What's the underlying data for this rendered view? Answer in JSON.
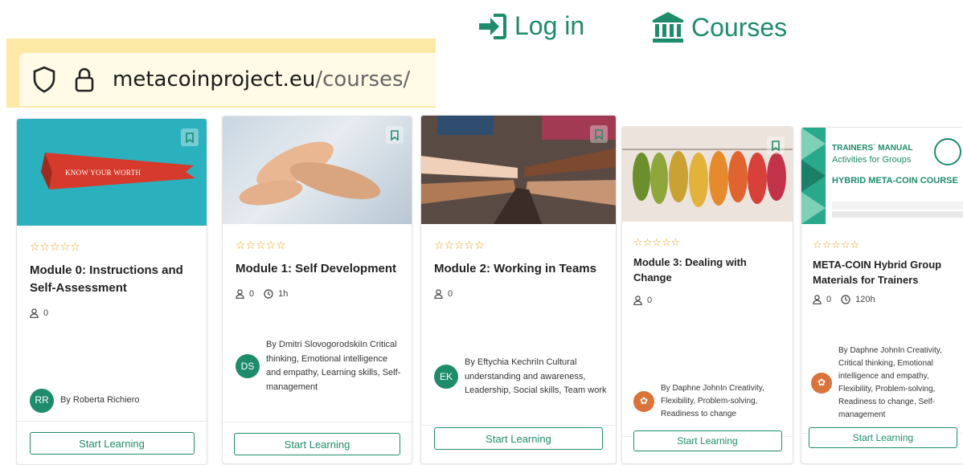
{
  "nav": {
    "login": "Log in",
    "courses": "Courses"
  },
  "browser": {
    "url_host": "metacoinproject.eu",
    "url_path": "/courses/"
  },
  "cards": [
    {
      "title": "Module 0: Instructions and Self-Assessment",
      "image_text": "KNOW YOUR WORTH",
      "students": "0",
      "duration": "",
      "avatar": "RR",
      "byline": "By Roberta Richiero",
      "button": "Start Learning"
    },
    {
      "title": "Module 1: Self Development",
      "students": "0",
      "duration": "1h",
      "avatar": "DS",
      "byline": "By Dmitri SlovogorodskiIn Critical thinking, Emotional intelligence and empathy, Learning skills, Self-management",
      "button": "Start Learning"
    },
    {
      "title": "Module 2: Working in Teams",
      "students": "0",
      "duration": "",
      "avatar": "EK",
      "byline": "By Eftychia KechriIn Cultural understanding and awareness, Leadership, Social skills, Team work",
      "button": "Start Learning"
    },
    {
      "title": "Module 3: Dealing with Change",
      "students": "0",
      "duration": "",
      "avatar": "",
      "byline": "By Daphne JohnIn Creativity, Flexibility, Problem-solving, Readiness to change",
      "button": "Start Learning"
    },
    {
      "title": "META-COIN Hybrid Group Materials for Trainers",
      "manual_line1": "TRAINERS´ MANUAL",
      "manual_line2": "Activities for Groups",
      "manual_line3": "HYBRID META-COIN COURSE",
      "students": "0",
      "duration": "120h",
      "avatar": "",
      "byline": "By Daphne JohnIn Creativity, Critical thinking, Emotional intelligence and empathy, Flexibility, Problem-solving, Readiness to change, Self-management",
      "button": "Start Learning"
    }
  ]
}
